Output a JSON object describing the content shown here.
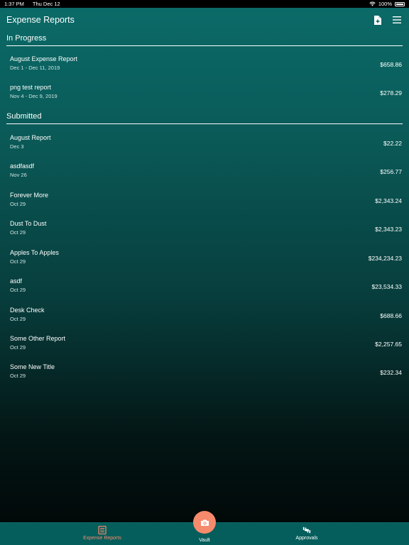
{
  "status": {
    "time": "1:37 PM",
    "date": "Thu Dec 12",
    "battery": "100%"
  },
  "header": {
    "title": "Expense Reports",
    "icons": [
      "add-report-icon",
      "menu-icon"
    ]
  },
  "sections": {
    "in_progress": {
      "title": "In Progress",
      "reports": [
        {
          "title": "August Expense Report",
          "date": "Dec 1 - Dec 11, 2019",
          "amount": "$658.86"
        },
        {
          "title": "png test report",
          "date": "Nov 4 - Dec 9, 2019",
          "amount": "$278.29"
        }
      ]
    },
    "submitted": {
      "title": "Submitted",
      "reports": [
        {
          "title": "August Report",
          "date": "Dec 3",
          "amount": "$22.22"
        },
        {
          "title": "asdfasdf",
          "date": "Nov 26",
          "amount": "$256.77"
        },
        {
          "title": "Forever More",
          "date": "Oct 29",
          "amount": "$2,343.24"
        },
        {
          "title": "Dust To Dust",
          "date": "Oct 29",
          "amount": "$2,343.23"
        },
        {
          "title": "Apples To Apples",
          "date": "Oct 29",
          "amount": "$234,234.23"
        },
        {
          "title": "asdf",
          "date": "Oct 29",
          "amount": "$23,534.33"
        },
        {
          "title": "Desk Check",
          "date": "Oct 29",
          "amount": "$688.66"
        },
        {
          "title": "Some Other Report",
          "date": "Oct 29",
          "amount": "$2,257.65"
        },
        {
          "title": "Some New Title",
          "date": "Oct 29",
          "amount": "$232.34"
        }
      ]
    }
  },
  "tabs": {
    "expense_reports": "Expense Reports",
    "vault": "Vault",
    "approvals": "Approvals"
  },
  "colors": {
    "accent": "#f58a6c",
    "tab_bar": "#055e5c",
    "background_top": "#0b6b68"
  }
}
